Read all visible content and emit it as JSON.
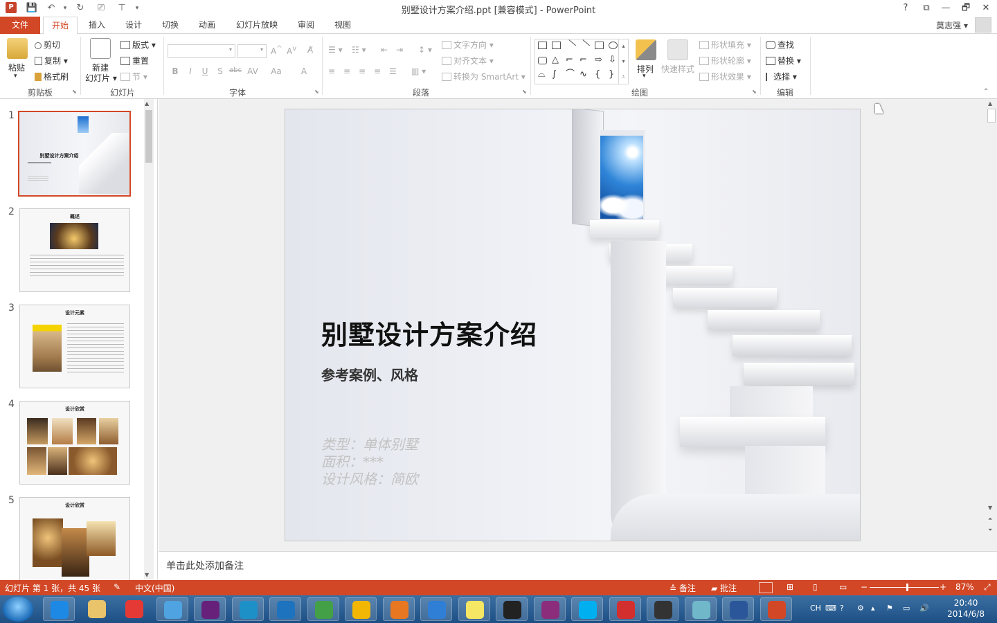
{
  "window": {
    "title": "别墅设计方案介绍.ppt [兼容模式] - PowerPoint",
    "help": "?",
    "controls": [
      "⧉",
      "—",
      "🗗",
      "✕"
    ]
  },
  "tabs": [
    {
      "label": "文件",
      "id": "file"
    },
    {
      "label": "开始",
      "id": "home",
      "active": true
    },
    {
      "label": "插入",
      "id": "insert"
    },
    {
      "label": "设计",
      "id": "design"
    },
    {
      "label": "切换",
      "id": "transitions"
    },
    {
      "label": "动画",
      "id": "animations"
    },
    {
      "label": "幻灯片放映",
      "id": "slideshow"
    },
    {
      "label": "审阅",
      "id": "review"
    },
    {
      "label": "视图",
      "id": "view"
    }
  ],
  "user": {
    "name": "莫志强"
  },
  "ribbon": {
    "clipboard": {
      "label": "剪贴板",
      "paste": "粘贴",
      "cut": "剪切",
      "copy": "复制",
      "format_painter": "格式刷"
    },
    "slides": {
      "label": "幻灯片",
      "new_slide_1": "新建",
      "new_slide_2": "幻灯片",
      "layout": "版式",
      "reset": "重置",
      "section": "节"
    },
    "font": {
      "label": "字体"
    },
    "paragraph": {
      "label": "段落",
      "text_direction": "文字方向",
      "align_text": "对齐文本",
      "smartart": "转换为 SmartArt"
    },
    "drawing": {
      "label": "绘图",
      "arrange": "排列",
      "quick_styles": "快速样式",
      "shape_fill": "形状填充",
      "shape_outline": "形状轮廓",
      "shape_effects": "形状效果"
    },
    "editing": {
      "label": "编辑",
      "find": "查找",
      "replace": "替换",
      "select": "选择"
    }
  },
  "thumbnails": [
    {
      "num": "1",
      "title": "别墅设计方案介绍"
    },
    {
      "num": "2",
      "title": "概述"
    },
    {
      "num": "3",
      "title": "设计元素"
    },
    {
      "num": "4",
      "title": "设计欣赏"
    },
    {
      "num": "5",
      "title": "设计欣赏"
    }
  ],
  "slide": {
    "title": "别墅设计方案介绍",
    "subtitle": "参考案例、风格",
    "info": [
      "类型：单体别墅",
      "面积：***",
      "设计风格：简欧"
    ]
  },
  "notes": {
    "placeholder": "单击此处添加备注"
  },
  "status": {
    "slide_info": "幻灯片 第 1 张，共 45 张",
    "language": "中文(中国)",
    "notes": "备注",
    "comments": "批注",
    "zoom": "87%",
    "zoom_fraction": 0.54
  },
  "taskbar": {
    "time": "20:40",
    "date": "2014/6/8",
    "lang": "CH",
    "apps": [
      {
        "name": "ie",
        "color": "#1e88e5"
      },
      {
        "name": "explorer",
        "color": "#e9c46a"
      },
      {
        "name": "chrome",
        "color": "#e53935"
      },
      {
        "name": "bird-app",
        "color": "#4fa3e0"
      },
      {
        "name": "visual-studio",
        "color": "#68217a"
      },
      {
        "name": "cloud-app",
        "color": "#1e90c8"
      },
      {
        "name": "sogou",
        "color": "#1e73be"
      },
      {
        "name": "pen-app",
        "color": "#43a047"
      },
      {
        "name": "sphere-app",
        "color": "#f2b705"
      },
      {
        "name": "media-player",
        "color": "#e87722"
      },
      {
        "name": "baidu-cloud",
        "color": "#2f7fd6"
      },
      {
        "name": "sticky-notes",
        "color": "#f5e663"
      },
      {
        "name": "shield-app",
        "color": "#222222"
      },
      {
        "name": "winrar",
        "color": "#8b2d7a"
      },
      {
        "name": "skype",
        "color": "#00aff0"
      },
      {
        "name": "acrobat",
        "color": "#d32f2f"
      },
      {
        "name": "camera-app",
        "color": "#333333"
      },
      {
        "name": "notes-app",
        "color": "#6fb7c9"
      },
      {
        "name": "word",
        "color": "#2b579a"
      },
      {
        "name": "powerpoint",
        "color": "#d24726"
      }
    ]
  },
  "colors": {
    "accent": "#d24726",
    "taskbar": "#1d4f84"
  }
}
